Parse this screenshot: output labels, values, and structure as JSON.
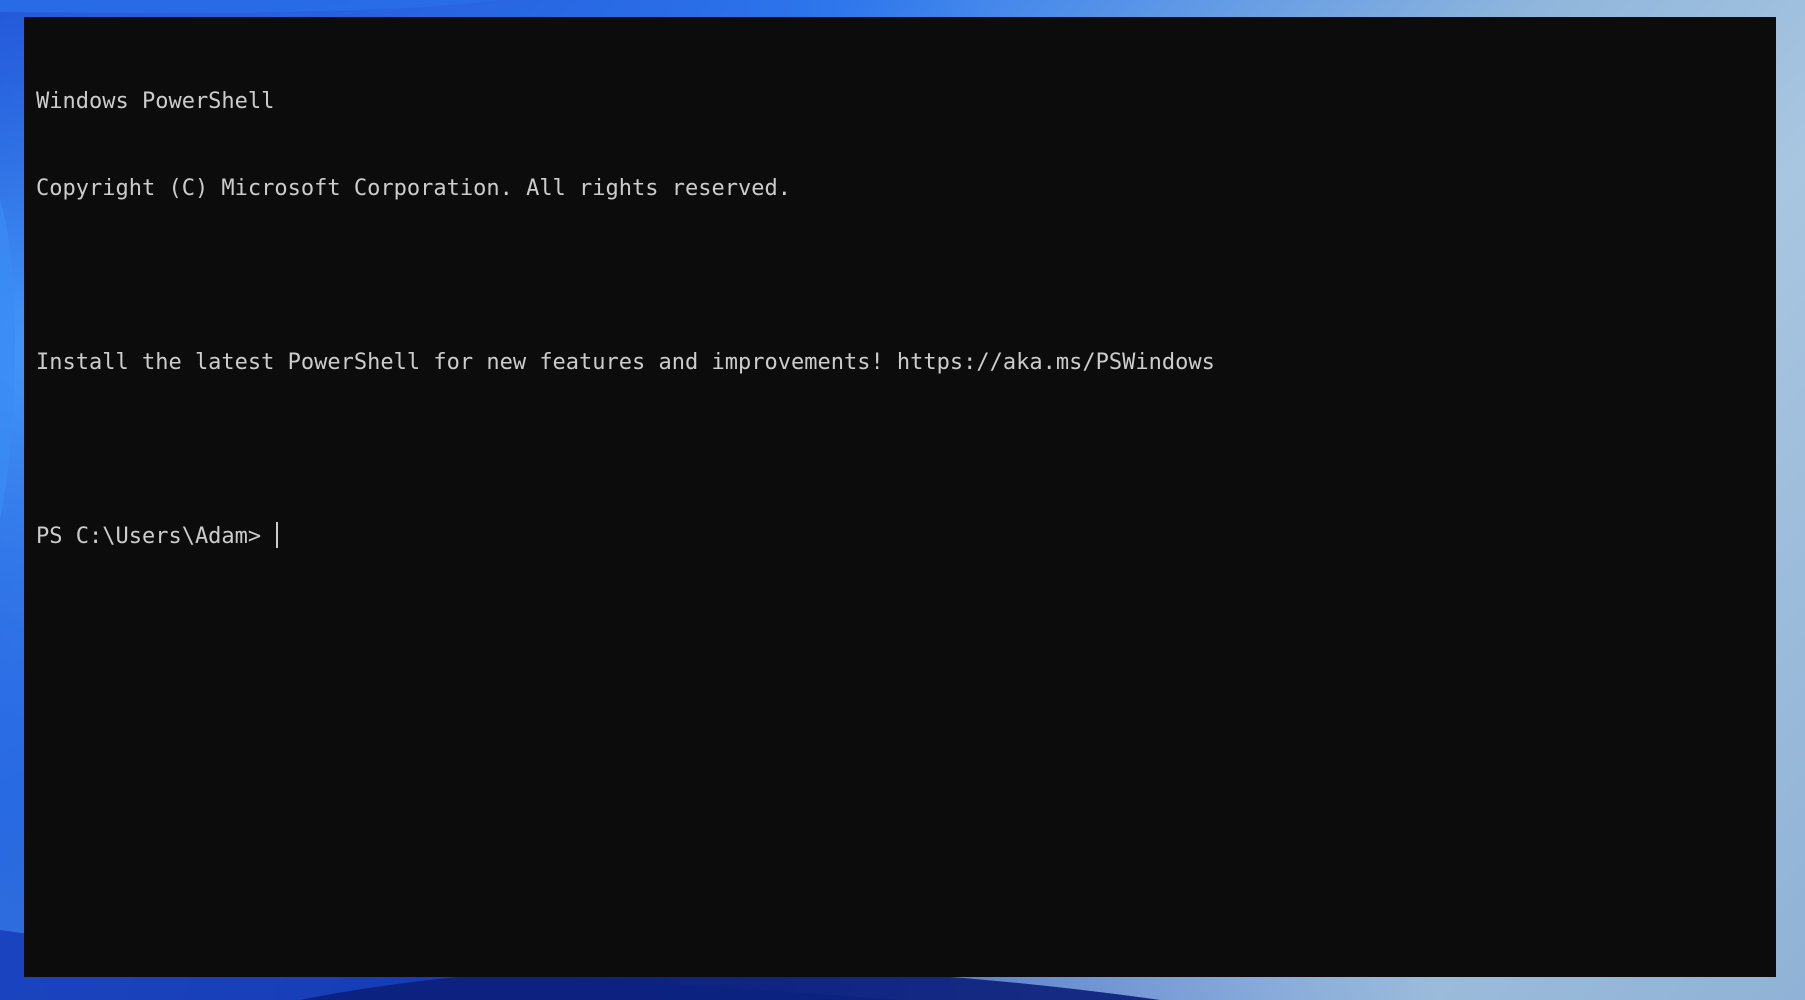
{
  "window": {
    "app": "Windows PowerShell"
  },
  "console": {
    "lines": [
      "Windows PowerShell",
      "Copyright (C) Microsoft Corporation. All rights reserved.",
      "",
      "Install the latest PowerShell for new features and improvements! https://aka.ms/PSWindows",
      ""
    ],
    "prompt": "PS C:\\Users\\Adam> "
  },
  "colors": {
    "background": "#0c0c0c",
    "foreground": "#cccccc",
    "wallpaper_accent": "#1c4fd8"
  }
}
